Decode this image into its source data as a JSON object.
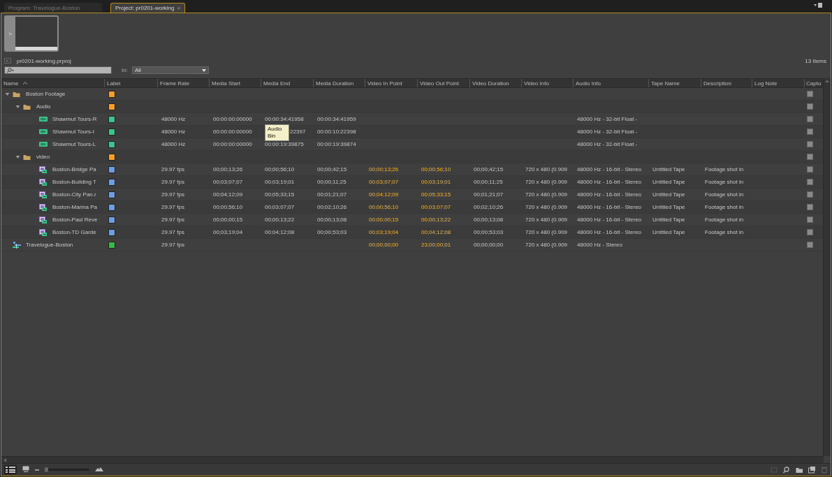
{
  "tabs": [
    {
      "label": "Program: Travelogue-Boston",
      "selected": false
    },
    {
      "label": "Project: pr0201-working",
      "selected": true,
      "close": "×"
    }
  ],
  "project": {
    "file_name": "pr0201-working.prproj",
    "item_count": "13 Items",
    "in_label": "In:",
    "in_value": "All"
  },
  "columns": [
    {
      "label": "Name",
      "sorted": true
    },
    {
      "label": "Label"
    },
    {
      "label": "Frame Rate",
      "highlighted": false
    },
    {
      "label": "Media Start",
      "highlighted": false
    },
    {
      "label": "Media End",
      "highlighted": false
    },
    {
      "label": "Media Duration",
      "highlighted": false
    },
    {
      "label": "Video In Point",
      "highlighted": true
    },
    {
      "label": "Video Out Point",
      "highlighted": true
    },
    {
      "label": "Video Duration",
      "highlighted": false
    },
    {
      "label": "Video Info",
      "highlighted": false
    },
    {
      "label": "Audio Info",
      "highlighted": false
    },
    {
      "label": "Tape Name",
      "highlighted": false
    },
    {
      "label": "Description",
      "highlighted": false
    },
    {
      "label": "Log Note"
    },
    {
      "label": "Captu"
    }
  ],
  "rows": [
    {
      "kind": "folder",
      "name": "Boston Footage",
      "color": "#f2a02a",
      "expanded": true,
      "capture": false,
      "children": [
        {
          "kind": "folder",
          "name": "Audio",
          "color": "#f2a02a",
          "expanded": true,
          "capture": false,
          "children": [
            {
              "kind": "audio",
              "name": "Shawmut Tours-R",
              "color": "#3cc48c",
              "capture": false,
              "frame_rate": "48000 Hz",
              "media_start": "00:00:00:00000",
              "media_end": "00:00:34:41958",
              "media_duration": "00:00:34:41959",
              "audio_info": "48000 Hz - 32-bit Float -"
            },
            {
              "kind": "audio",
              "name": "Shawmut Tours-I",
              "color": "#3cc48c",
              "capture": false,
              "covered": true,
              "frame_rate": "48000 Hz",
              "media_start": "00:00:00:00000",
              "media_end": ":22397",
              "media_duration": "00:00:10:22398",
              "audio_info": "48000 Hz - 32-bit Float -"
            },
            {
              "kind": "audio",
              "name": "Shawmut Tours-L",
              "color": "#3cc48c",
              "capture": false,
              "frame_rate": "48000 Hz",
              "media_start": "00:00:00:00000",
              "media_end": "00:00:19:39875",
              "media_duration": "00:00:19:39874",
              "audio_info": "48000 Hz - 32-bit Float -"
            }
          ]
        },
        {
          "kind": "folder",
          "name": "video",
          "color": "#f2a02a",
          "expanded": true,
          "capture": false,
          "children": [
            {
              "kind": "video",
              "name": "Boston-Bridge Pa",
              "color": "#6c9ee0",
              "capture": false,
              "frame_rate": "29.97 fps",
              "media_start": "00;00;13;26",
              "media_end": "00;00;56;10",
              "media_duration": "00;00;42;15",
              "video_in": "00;00;13;26",
              "video_out": "00;00;56;10",
              "video_duration": "00;00;42;15",
              "video_info": "720 x 480 (0.909",
              "audio_info": "48000 Hz - 16-bit - Stereo",
              "tape_name": "Untitled Tape",
              "description": "Footage shot in"
            },
            {
              "kind": "video",
              "name": "Boston-Building T",
              "color": "#6c9ee0",
              "capture": false,
              "frame_rate": "29.97 fps",
              "media_start": "00;03;07;07",
              "media_end": "00;03;19;01",
              "media_duration": "00;00;11;25",
              "video_in": "00;03;07;07",
              "video_out": "00;03;19;01",
              "video_duration": "00;00;11;25",
              "video_info": "720 x 480 (0.909",
              "audio_info": "48000 Hz - 16-bit - Stereo",
              "tape_name": "Untitled Tape",
              "description": "Footage shot in"
            },
            {
              "kind": "video",
              "name": "Boston-City Pan.r",
              "color": "#6c9ee0",
              "capture": false,
              "frame_rate": "29.97 fps",
              "media_start": "00;04;12;09",
              "media_end": "00;05;33;15",
              "media_duration": "00;01;21;07",
              "video_in": "00;04;12;09",
              "video_out": "00;05;33;15",
              "video_duration": "00;01;21;07",
              "video_info": "720 x 480 (0.909",
              "audio_info": "48000 Hz - 16-bit - Stereo",
              "tape_name": "Untitled Tape",
              "description": "Footage shot in"
            },
            {
              "kind": "video",
              "name": "Boston-Marina Pa",
              "color": "#6c9ee0",
              "capture": false,
              "frame_rate": "29.97 fps",
              "media_start": "00;00;56;10",
              "media_end": "00;03;07;07",
              "media_duration": "00;02;10;26",
              "video_in": "00;00;56;10",
              "video_out": "00;03;07;07",
              "video_duration": "00;02;10;26",
              "video_info": "720 x 480 (0.909",
              "audio_info": "48000 Hz - 16-bit - Stereo",
              "tape_name": "Untitled Tape",
              "description": "Footage shot in"
            },
            {
              "kind": "video",
              "name": "Boston-Paul Reve",
              "color": "#6c9ee0",
              "capture": false,
              "frame_rate": "29.97 fps",
              "media_start": "00;00;00;15",
              "media_end": "00;00;13;22",
              "media_duration": "00;00;13;08",
              "video_in": "00;00;00;15",
              "video_out": "00;00;13;22",
              "video_duration": "00;00;13;08",
              "video_info": "720 x 480 (0.909",
              "audio_info": "48000 Hz - 16-bit - Stereo",
              "tape_name": "Untitled Tape",
              "description": "Footage shot in"
            },
            {
              "kind": "video",
              "name": "Boston-TD Garde",
              "color": "#6c9ee0",
              "capture": false,
              "frame_rate": "29.97 fps",
              "media_start": "00;03;19;04",
              "media_end": "00;04;12;08",
              "media_duration": "00;00;53;03",
              "video_in": "00;03;19;04",
              "video_out": "00;04;12;08",
              "video_duration": "00;00;53;03",
              "video_info": "720 x 480 (0.909",
              "audio_info": "48000 Hz - 16-bit - Stereo",
              "tape_name": "Untitled Tape",
              "description": "Footage shot in"
            }
          ]
        }
      ]
    },
    {
      "kind": "sequence",
      "name": "Travelogue-Boston",
      "color": "#3cb84a",
      "capture": false,
      "frame_rate": "29.97 fps",
      "video_in": "00;00;00;00",
      "video_out": "23;00;00;01",
      "video_duration": "00;00;00;00",
      "video_info": "720 x 480 (0.909",
      "audio_info": "48000 Hz - Stereo"
    }
  ],
  "tooltip": {
    "text": "Audio Bin"
  },
  "footer": {
    "zoom_slider": {
      "level": 0
    }
  }
}
